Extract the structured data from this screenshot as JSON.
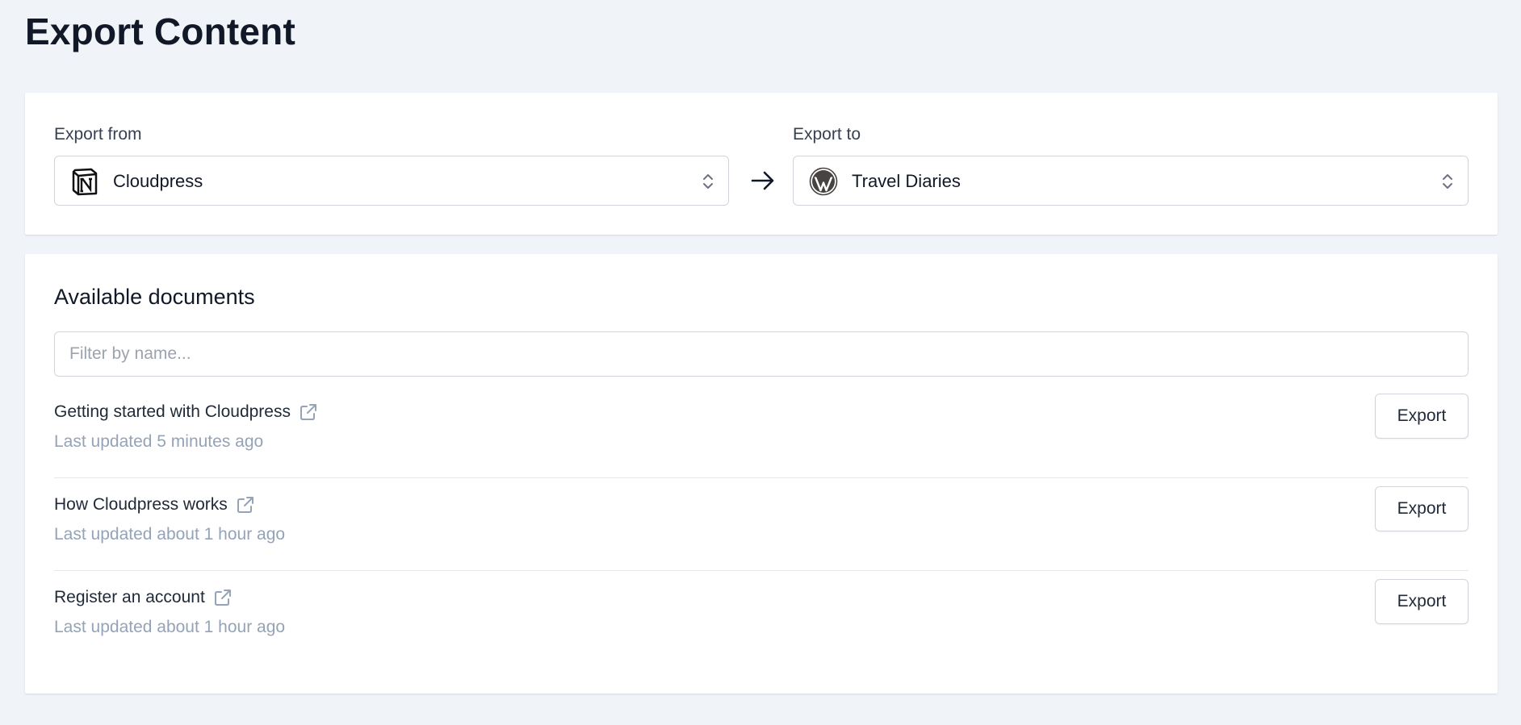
{
  "page": {
    "title": "Export Content"
  },
  "source": {
    "from_label": "Export from",
    "from_value": "Cloudpress",
    "from_icon": "notion-logo-icon",
    "to_label": "Export to",
    "to_value": "Travel Diaries",
    "to_icon": "wordpress-logo-icon",
    "arrow_icon": "arrow-right-icon"
  },
  "documents": {
    "title": "Available documents",
    "filter_placeholder": "Filter by name...",
    "items": [
      {
        "title": "Getting started with Cloudpress",
        "updated": "Last updated 5 minutes ago",
        "action": "Export"
      },
      {
        "title": "How Cloudpress works",
        "updated": "Last updated about 1 hour ago",
        "action": "Export"
      },
      {
        "title": "Register an account",
        "updated": "Last updated about 1 hour ago",
        "action": "Export"
      }
    ]
  },
  "colors": {
    "background": "#f0f3f8",
    "card": "#ffffff",
    "muted_text": "#94a3b8",
    "border": "#d1d5db"
  }
}
